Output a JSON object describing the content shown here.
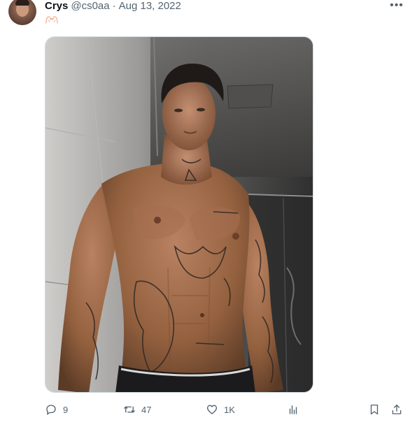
{
  "tweet": {
    "author": {
      "display_name": "Crys",
      "handle": "@cs0aa"
    },
    "separator": "·",
    "date": "Aug 13, 2022",
    "text_icon": "raised-hands-emoji",
    "media_icon": "shirtless-man-photo",
    "more_icon": "more-horizontal-icon",
    "actions": {
      "reply_count": "9",
      "retweet_count": "47",
      "like_count": "1K",
      "views_count": ""
    }
  },
  "colors": {
    "text_primary": "#0f1419",
    "text_secondary": "#536471",
    "border": "#cfd9de",
    "background": "#ffffff",
    "emoji": "#f3b49a"
  }
}
